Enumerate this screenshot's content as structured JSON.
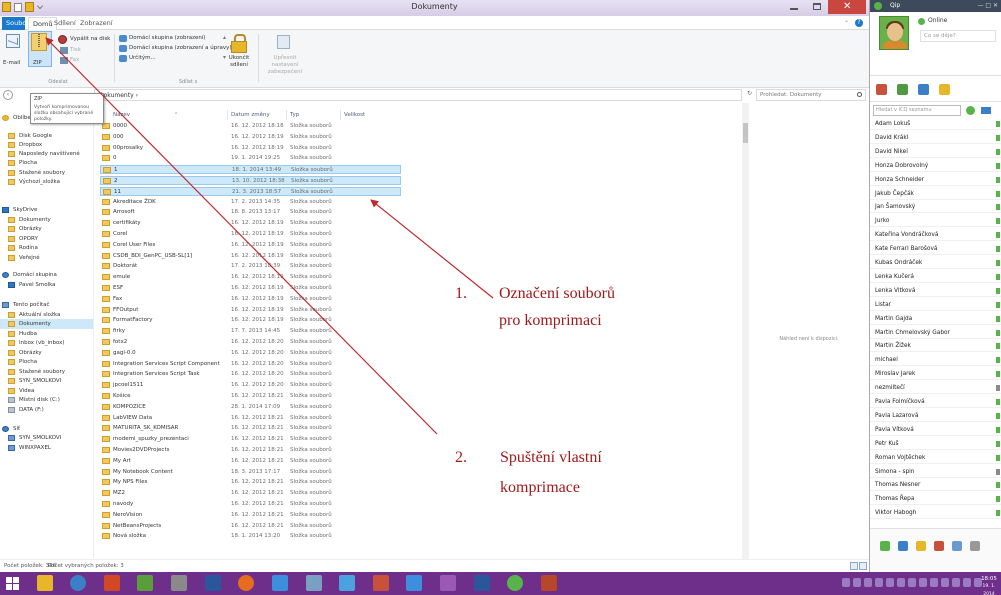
{
  "window": {
    "title": "Dokumenty"
  },
  "tabs": [
    "Soubor",
    "Domů",
    "Sdílení",
    "Zobrazení"
  ],
  "ribbon": {
    "email": "E-mail",
    "zip": "ZIP",
    "burn": "Vypálit na disk",
    "print": "Tisk",
    "fax": "Fax",
    "share_homegroup_view": "Domácí skupina (zobrazení)",
    "share_homegroup_edit": "Domácí skupina (zobrazení a úpravy)",
    "share_specific": "Určitým...",
    "stop_sharing": "Ukončit sdílení",
    "advanced_security": "Upřesnit nastavení zabezpečení",
    "group_send": "Odeslat",
    "group_share": "Sdílet s"
  },
  "tooltip": {
    "title": "ZIP",
    "body": "Vytvoří komprimovanou složku obsahující vybrané položky."
  },
  "address": {
    "path": "Dokumenty",
    "search_placeholder": "Prohledat: Dokumenty"
  },
  "columns": {
    "name": "Název",
    "date": "Datum změny",
    "type": "Typ",
    "size": "Velikost"
  },
  "nav": [
    {
      "label": "Oblíbené",
      "icon": "star-icon"
    },
    {
      "label": "Disk Google",
      "icon": "folder-icon"
    },
    {
      "label": "Dropbox",
      "icon": "folder-icon"
    },
    {
      "label": "Naposledy navštívené",
      "icon": "folder-icon"
    },
    {
      "label": "Plocha",
      "icon": "folder-icon"
    },
    {
      "label": "Stažené soubory",
      "icon": "folder-icon"
    },
    {
      "label": "Výchozí_složka",
      "icon": "folder-icon"
    },
    {
      "label": "SkyDrive",
      "icon": "cloud-icon"
    },
    {
      "label": "Dokumenty",
      "icon": "folder-icon"
    },
    {
      "label": "Obrázky",
      "icon": "folder-icon"
    },
    {
      "label": "OPORY",
      "icon": "folder-icon"
    },
    {
      "label": "Rodina",
      "icon": "folder-icon"
    },
    {
      "label": "Veřejné",
      "icon": "folder-icon"
    },
    {
      "label": "Domácí skupina",
      "icon": "homegroup-icon"
    },
    {
      "label": "Pavel Smolka",
      "icon": "user-icon"
    },
    {
      "label": "Tento počítač",
      "icon": "computer-icon"
    },
    {
      "label": "Aktuální složka",
      "icon": "folder-icon"
    },
    {
      "label": "Dokumenty",
      "icon": "folder-icon"
    },
    {
      "label": "Hudba",
      "icon": "folder-icon"
    },
    {
      "label": "Inbox (vb_inbox)",
      "icon": "folder-icon"
    },
    {
      "label": "Obrázky",
      "icon": "folder-icon"
    },
    {
      "label": "Plocha",
      "icon": "folder-icon"
    },
    {
      "label": "Stažené soubory",
      "icon": "folder-icon"
    },
    {
      "label": "SYN_SMOLKOVI",
      "icon": "folder-icon"
    },
    {
      "label": "Videa",
      "icon": "folder-icon"
    },
    {
      "label": "Místní disk (C:)",
      "icon": "drive-icon"
    },
    {
      "label": "DATA (F:)",
      "icon": "drive-icon"
    },
    {
      "label": "Síť",
      "icon": "network-icon"
    },
    {
      "label": "SYN_SMOLKOVI",
      "icon": "computer-icon"
    },
    {
      "label": "WINXPAXEL",
      "icon": "computer-icon"
    }
  ],
  "files": [
    {
      "name": "0000",
      "date": "16. 12. 2012 18:18",
      "type": "Složka souborů",
      "selected": false
    },
    {
      "name": "000",
      "date": "16. 12. 2012 18:19",
      "type": "Složka souborů",
      "selected": false
    },
    {
      "name": "00prosalky",
      "date": "16. 12. 2012 18:19",
      "type": "Složka souborů",
      "selected": false
    },
    {
      "name": "0",
      "date": "19. 1. 2014 19:25",
      "type": "Složka souborů",
      "selected": false
    },
    {
      "name": "1",
      "date": "18. 1. 2014 13:49",
      "type": "Složka souborů",
      "selected": true
    },
    {
      "name": "2",
      "date": "13. 10. 2012 18:38",
      "type": "Složka souborů",
      "selected": true
    },
    {
      "name": "11",
      "date": "21. 3. 2013 18:57",
      "type": "Složka souborů",
      "selected": true
    },
    {
      "name": "Akreditace ŽDK",
      "date": "17. 2. 2013 14:35",
      "type": "Složka souborů",
      "selected": false
    },
    {
      "name": "Arrosoft",
      "date": "18. 8. 2013 13:17",
      "type": "Složka souborů",
      "selected": false
    },
    {
      "name": "certifikáty",
      "date": "16. 12. 2012 18:19",
      "type": "Složka souborů",
      "selected": false
    },
    {
      "name": "Corel",
      "date": "16. 12. 2012 18:19",
      "type": "Složka souborů",
      "selected": false
    },
    {
      "name": "Corel User Files",
      "date": "16. 12. 2012 18:19",
      "type": "Složka souborů",
      "selected": false
    },
    {
      "name": "CSDB_BDI_GenPC_USB-SL[1]",
      "date": "16. 12. 2012 18:19",
      "type": "Složka souborů",
      "selected": false
    },
    {
      "name": "Doktorát",
      "date": "17. 2. 2013 18:39",
      "type": "Složka souborů",
      "selected": false
    },
    {
      "name": "emule",
      "date": "16. 12. 2012 18:19",
      "type": "Složka souborů",
      "selected": false
    },
    {
      "name": "ESF",
      "date": "16. 12. 2012 18:19",
      "type": "Složka souborů",
      "selected": false
    },
    {
      "name": "Fax",
      "date": "16. 12. 2012 18:19",
      "type": "Složka souborů",
      "selected": false
    },
    {
      "name": "FFOutput",
      "date": "16. 12. 2012 18:19",
      "type": "Složka souborů",
      "selected": false
    },
    {
      "name": "FormatFactory",
      "date": "16. 12. 2012 18:19",
      "type": "Složka souborů",
      "selected": false
    },
    {
      "name": "firky",
      "date": "17. 7. 2013 14:45",
      "type": "Složka souborů",
      "selected": false
    },
    {
      "name": "fotx2",
      "date": "16. 12. 2012 18:20",
      "type": "Složka souborů",
      "selected": false
    },
    {
      "name": "gagl-0.0",
      "date": "16. 12. 2012 18:20",
      "type": "Složka souborů",
      "selected": false
    },
    {
      "name": "Integration Services Script Component",
      "date": "16. 12. 2012 18:20",
      "type": "Složka souborů",
      "selected": false
    },
    {
      "name": "Integration Services Script Task",
      "date": "16. 12. 2012 18:20",
      "type": "Složka souborů",
      "selected": false
    },
    {
      "name": "jpcoel1511",
      "date": "16. 12. 2012 18:20",
      "type": "Složka souborů",
      "selected": false
    },
    {
      "name": "Košice",
      "date": "16. 12. 2012 18:21",
      "type": "Složka souborů",
      "selected": false
    },
    {
      "name": "KOMPOZICE",
      "date": "28. 1. 2014 17:09",
      "type": "Složka souborů",
      "selected": false
    },
    {
      "name": "LabVIEW Data",
      "date": "16. 12. 2012 18:21",
      "type": "Složka souborů",
      "selected": false
    },
    {
      "name": "MATURITA_SK_KOMISAR",
      "date": "16. 12. 2012 18:21",
      "type": "Složka souborů",
      "selected": false
    },
    {
      "name": "modemi_spuzky_prezentaci",
      "date": "16. 12. 2012 18:21",
      "type": "Složka souborů",
      "selected": false
    },
    {
      "name": "Movies2DVDProjects",
      "date": "16. 12. 2012 18:21",
      "type": "Složka souborů",
      "selected": false
    },
    {
      "name": "My Art",
      "date": "16. 12. 2012 18:21",
      "type": "Složka souborů",
      "selected": false
    },
    {
      "name": "My Notebook Content",
      "date": "18. 3. 2013 17:17",
      "type": "Složka souborů",
      "selected": false
    },
    {
      "name": "My NPS Files",
      "date": "16. 12. 2012 18:21",
      "type": "Složka souborů",
      "selected": false
    },
    {
      "name": "MZ2",
      "date": "16. 12. 2012 18:21",
      "type": "Složka souborů",
      "selected": false
    },
    {
      "name": "navody",
      "date": "16. 12. 2012 18:21",
      "type": "Složka souborů",
      "selected": false
    },
    {
      "name": "NeroVision",
      "date": "16. 12. 2012 18:21",
      "type": "Složka souborů",
      "selected": false
    },
    {
      "name": "NetBeansProjects",
      "date": "16. 12. 2012 18:21",
      "type": "Složka souborů",
      "selected": false
    },
    {
      "name": "Nová složka",
      "date": "18. 1. 2014 13:20",
      "type": "Složka souborů",
      "selected": false
    }
  ],
  "empty_hint": "Náhled není k dispozici.",
  "status": {
    "count": "Počet položek: 326",
    "selected": "Počet vybraných položek: 3"
  },
  "chat": {
    "app_name": "Qip",
    "user_status": "Online",
    "mood_placeholder": "Co se děje?",
    "search_placeholder": "Hledat v ICQ seznamu",
    "contacts": [
      {
        "name": "Adam Lokuš",
        "status": "online"
      },
      {
        "name": "David Krákl",
        "status": "online"
      },
      {
        "name": "David Nikel",
        "status": "online"
      },
      {
        "name": "Honza Dobrovolný",
        "status": "online"
      },
      {
        "name": "Honza Schneider",
        "status": "online"
      },
      {
        "name": "Jakub Čepčák",
        "status": "online"
      },
      {
        "name": "Jan Šamovský",
        "status": "online"
      },
      {
        "name": "Jurko",
        "status": "online"
      },
      {
        "name": "Kateřina Vondráčková",
        "status": "online"
      },
      {
        "name": "Kate Ferrari Barošová",
        "status": "online"
      },
      {
        "name": "Kubas Ondráček",
        "status": "online"
      },
      {
        "name": "Lenka Kučerá",
        "status": "online"
      },
      {
        "name": "Lenka Vitková",
        "status": "online"
      },
      {
        "name": "Listar",
        "status": "online"
      },
      {
        "name": "Martin Gajda",
        "status": "online"
      },
      {
        "name": "Martin Chmelovský Gabor",
        "status": "online"
      },
      {
        "name": "Martin Žižek",
        "status": "online"
      },
      {
        "name": "michael",
        "status": "online"
      },
      {
        "name": "Miroslav Jarek",
        "status": "online"
      },
      {
        "name": "nezmiltečí",
        "status": "away"
      },
      {
        "name": "Pavla Folmíčková",
        "status": "online"
      },
      {
        "name": "Pavla Lazarová",
        "status": "online"
      },
      {
        "name": "Pavla Vítková",
        "status": "online"
      },
      {
        "name": "Petr Kuš",
        "status": "online"
      },
      {
        "name": "Roman Vojtěchek",
        "status": "online"
      },
      {
        "name": "Simona - spin",
        "status": "away"
      },
      {
        "name": "Thomas Nesner",
        "status": "online"
      },
      {
        "name": "Thomas Řepa",
        "status": "online"
      },
      {
        "name": "Viktor Habogh",
        "status": "online"
      }
    ]
  },
  "taskbar": {
    "time": "18:05",
    "date": "19. 1. 2014"
  },
  "annotations": [
    {
      "num": "1.",
      "text1": "Označení souborů",
      "text2": "pro komprimaci"
    },
    {
      "num": "2.",
      "text1": "Spuštění vlastní",
      "text2": "komprimace"
    }
  ],
  "colors": {
    "accent": "#1979ca",
    "selection": "#cde8f9",
    "annotation": "#a01a1a",
    "taskbar": "#6d2f8a"
  }
}
